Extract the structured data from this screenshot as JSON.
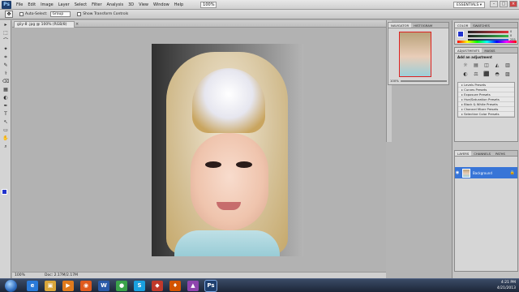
{
  "app": {
    "logo": "Ps",
    "menu": [
      "File",
      "Edit",
      "Image",
      "Layer",
      "Select",
      "Filter",
      "Analysis",
      "3D",
      "View",
      "Window",
      "Help"
    ],
    "zoom_menu_value": "100%",
    "workspace_button": "ESSENTIALS ▾",
    "window_controls": [
      "–",
      "□",
      "×"
    ]
  },
  "options_bar": {
    "auto_select_label": "Auto-Select:",
    "auto_select_value": "Group",
    "show_transform_label": "Show Transform Controls"
  },
  "tools": [
    "▸",
    "⬚",
    "⌒",
    "✦",
    "⌗",
    "✎",
    "⚕",
    "⌫",
    "▦",
    "◐",
    "✒",
    "T",
    "↖",
    "▭",
    "✋",
    "⌕"
  ],
  "document": {
    "tab_name": "giiy-8 .jpg @ 100% (RGB/8)",
    "tab_close": "×",
    "zoom_status": "100%",
    "doc_info": "Doc: 2.17M/2.17M"
  },
  "navigator": {
    "tabs": [
      "NAVIGATOR",
      "HISTOGRAM"
    ],
    "zoom_value": "100%"
  },
  "color_panel": {
    "tabs": [
      "COLOR",
      "SWATCHES"
    ],
    "channels": [
      {
        "name": "R",
        "value": "0",
        "color": "#e0303a"
      },
      {
        "name": "G",
        "value": "0",
        "color": "#35b84a"
      },
      {
        "name": "B",
        "value": "255",
        "color": "#2f5be0"
      }
    ],
    "foreground": "#2233cc"
  },
  "adjustments": {
    "tabs": [
      "ADJUSTMENTS",
      "MASKS"
    ],
    "header": "Add an adjustment",
    "icons": [
      "☼",
      "▤",
      "◫",
      "◭",
      "▥",
      "◐",
      "⚖",
      "⬛",
      "◓",
      "▨"
    ],
    "presets": [
      "Levels Presets",
      "Curves Presets",
      "Exposure Presets",
      "Hue/Saturation Presets",
      "Black & White Presets",
      "Channel Mixer Presets",
      "Selective Color Presets"
    ]
  },
  "layers": {
    "tabs": [
      "LAYERS",
      "CHANNELS",
      "PATHS"
    ],
    "items": [
      {
        "name": "Background",
        "visible_icon": "eye-icon",
        "lock": "lock-icon"
      }
    ],
    "selected_color": "#3875d7"
  },
  "taskbar": {
    "time": "4:21 PM",
    "date": "4/21/2013",
    "apps": [
      {
        "name": "ie",
        "glyph": "e",
        "color": "#2a7ad8"
      },
      {
        "name": "explorer",
        "glyph": "▣",
        "color": "#d9a63a"
      },
      {
        "name": "media",
        "glyph": "▶",
        "color": "#e07a1c"
      },
      {
        "name": "firefox",
        "glyph": "◉",
        "color": "#e05a1e"
      },
      {
        "name": "word",
        "glyph": "W",
        "color": "#2a5aa8"
      },
      {
        "name": "chrome",
        "glyph": "●",
        "color": "#3aa24a"
      },
      {
        "name": "skype",
        "glyph": "S",
        "color": "#1aa0e0"
      },
      {
        "name": "app8",
        "glyph": "◆",
        "color": "#c0392b"
      },
      {
        "name": "app9",
        "glyph": "♦",
        "color": "#d35400"
      },
      {
        "name": "app10",
        "glyph": "▲",
        "color": "#8e44ad"
      },
      {
        "name": "photoshop",
        "glyph": "Ps",
        "color": "#1e3f6e"
      }
    ]
  }
}
